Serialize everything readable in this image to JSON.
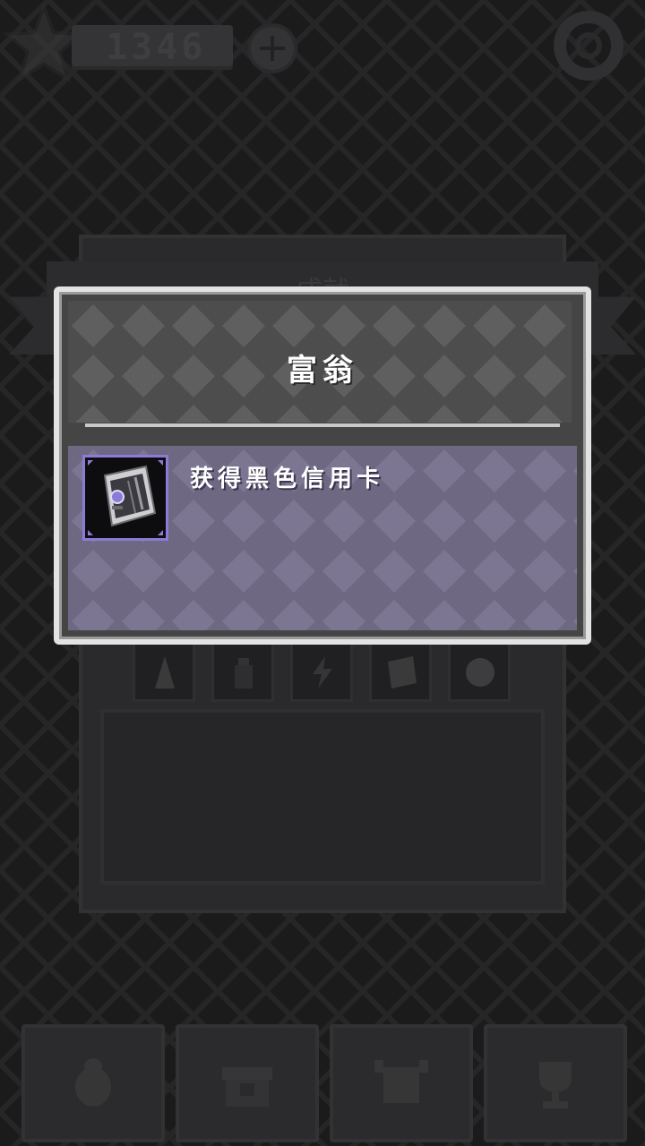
{
  "topbar": {
    "currency_value": "1346",
    "icons": [
      "star-icon",
      "plus-icon",
      "settings-icon"
    ]
  },
  "achievements_screen": {
    "title": "成就",
    "slots": [
      "wizard-hat-icon",
      "bottle-icon",
      "lightning-icon",
      "credit-card-icon",
      "ball-icon"
    ]
  },
  "bottom_nav": {
    "items": [
      "bug-icon",
      "chest-icon",
      "monster-icon",
      "trophy-icon"
    ]
  },
  "modal": {
    "title": "富翁",
    "description": "获得黑色信用卡",
    "icon": "black-credit-card-icon",
    "colors": {
      "header_bg": "#4e4e4f",
      "body_bg": "#726b86",
      "icon_border": "#8c7bd6"
    }
  }
}
